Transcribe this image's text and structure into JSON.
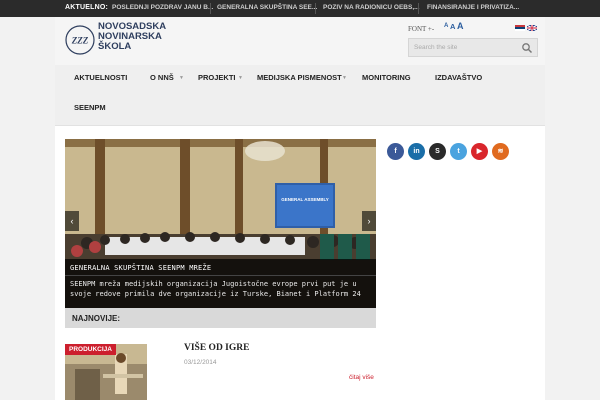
{
  "ticker": {
    "label": "AKTUELNO:",
    "items": [
      "POSLEDNJI POZDRAV JANU B...",
      "GENERALNA SKUPŠTINA SEE...",
      "POZIV NA RADIONICU OEBS,...",
      "FINANSIRANJE I PRIVATIZA..."
    ]
  },
  "logo": {
    "lines": [
      "NOVOSADSKA",
      "NOVINARSKA",
      "ŠKOLA"
    ],
    "monogram": "ZZZ"
  },
  "font_control": {
    "label": "FONT +-",
    "sizes": [
      "A",
      "A",
      "A"
    ]
  },
  "search": {
    "placeholder": "Search the site"
  },
  "nav": {
    "items": [
      "AKTUELNOSTI",
      "O NNŠ",
      "PROJEKTI",
      "MEDIJSKA PISMENOST",
      "MONITORING",
      "IZDAVAŠTVO",
      "SEENPM"
    ]
  },
  "slider": {
    "title": "GENERALNA SKUPŠTINA SEENPM MREŽE",
    "text": "SEENPM mreža medijskih organizacija Jugoistočne evrope prvi put je u svoje redove primila dve organizacije iz Turske, Bianet i Platform 24",
    "screen_text": "GENERAL ASSEMBLY",
    "prev": "‹",
    "next": "›"
  },
  "social": [
    {
      "name": "facebook",
      "glyph": "f",
      "color": "#3b5998"
    },
    {
      "name": "linkedin",
      "glyph": "in",
      "color": "#1a6ea8"
    },
    {
      "name": "skype",
      "glyph": "S",
      "color": "#2a2a2a"
    },
    {
      "name": "twitter",
      "glyph": "t",
      "color": "#4aa3df"
    },
    {
      "name": "youtube",
      "glyph": "▶",
      "color": "#d9262c"
    },
    {
      "name": "rss",
      "glyph": "≋",
      "color": "#e06a1f"
    }
  ],
  "latest": {
    "label": "NAJNOVIJE:"
  },
  "post": {
    "tag": "PRODUKCIJA",
    "title": "VIŠE OD IGRE",
    "date": "03/12/2014",
    "more": "čitaj više"
  }
}
